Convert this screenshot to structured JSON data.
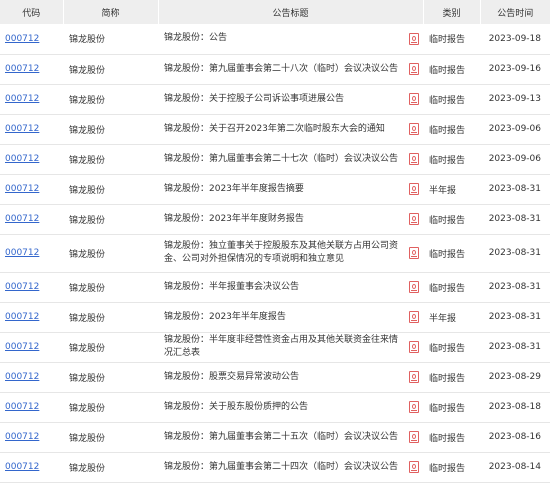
{
  "headers": {
    "code": "代码",
    "name": "简称",
    "title": "公告标题",
    "type": "类别",
    "date": "公告时间"
  },
  "icon": "pdf-icon",
  "colors": {
    "link": "#3366cc",
    "header_bg": "#eeeeee",
    "pdf": "#e06060"
  },
  "rows": [
    {
      "code": "000712",
      "name": "锦龙股份",
      "title": "锦龙股份：公告",
      "type": "临时报告",
      "date": "2023-09-18"
    },
    {
      "code": "000712",
      "name": "锦龙股份",
      "title": "锦龙股份：第九届董事会第二十八次（临时）会议决议公告",
      "type": "临时报告",
      "date": "2023-09-16"
    },
    {
      "code": "000712",
      "name": "锦龙股份",
      "title": "锦龙股份：关于控股子公司诉讼事项进展公告",
      "type": "临时报告",
      "date": "2023-09-13"
    },
    {
      "code": "000712",
      "name": "锦龙股份",
      "title": "锦龙股份：关于召开2023年第二次临时股东大会的通知",
      "type": "临时报告",
      "date": "2023-09-06"
    },
    {
      "code": "000712",
      "name": "锦龙股份",
      "title": "锦龙股份：第九届董事会第二十七次（临时）会议决议公告",
      "type": "临时报告",
      "date": "2023-09-06"
    },
    {
      "code": "000712",
      "name": "锦龙股份",
      "title": "锦龙股份：2023年半年度报告摘要",
      "type": "半年报",
      "date": "2023-08-31"
    },
    {
      "code": "000712",
      "name": "锦龙股份",
      "title": "锦龙股份：2023年半年度财务报告",
      "type": "临时报告",
      "date": "2023-08-31"
    },
    {
      "code": "000712",
      "name": "锦龙股份",
      "title": "锦龙股份：独立董事关于控股股东及其他关联方占用公司资金、公司对外担保情况的专项说明和独立意见",
      "type": "临时报告",
      "date": "2023-08-31",
      "tall": true
    },
    {
      "code": "000712",
      "name": "锦龙股份",
      "title": "锦龙股份：半年报董事会决议公告",
      "type": "临时报告",
      "date": "2023-08-31"
    },
    {
      "code": "000712",
      "name": "锦龙股份",
      "title": "锦龙股份：2023年半年度报告",
      "type": "半年报",
      "date": "2023-08-31"
    },
    {
      "code": "000712",
      "name": "锦龙股份",
      "title": "锦龙股份：半年度非经营性资金占用及其他关联资金往来情况汇总表",
      "type": "临时报告",
      "date": "2023-08-31"
    },
    {
      "code": "000712",
      "name": "锦龙股份",
      "title": "锦龙股份：股票交易异常波动公告",
      "type": "临时报告",
      "date": "2023-08-29"
    },
    {
      "code": "000712",
      "name": "锦龙股份",
      "title": "锦龙股份：关于股东股份质押的公告",
      "type": "临时报告",
      "date": "2023-08-18"
    },
    {
      "code": "000712",
      "name": "锦龙股份",
      "title": "锦龙股份：第九届董事会第二十五次（临时）会议决议公告",
      "type": "临时报告",
      "date": "2023-08-16"
    },
    {
      "code": "000712",
      "name": "锦龙股份",
      "title": "锦龙股份：第九届董事会第二十四次（临时）会议决议公告",
      "type": "临时报告",
      "date": "2023-08-14"
    }
  ]
}
